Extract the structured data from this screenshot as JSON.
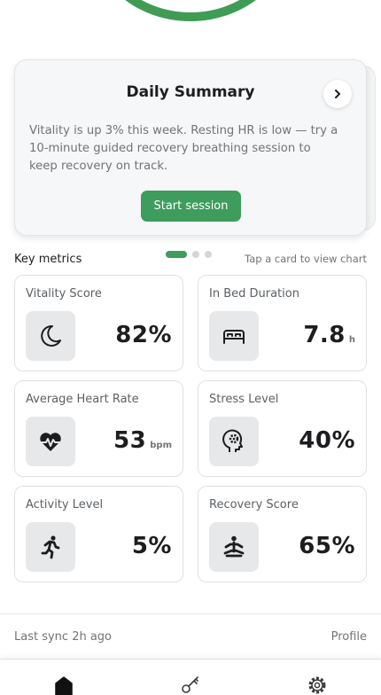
{
  "summary": {
    "title": "Daily Summary",
    "body": "Vitality is up 3% this week. Resting HR is low — try a 10-minute guided recovery breathing session to keep recovery on track.",
    "button_label": "Start session",
    "next_icon": "chevron-right-icon",
    "pager": {
      "count": 3,
      "active": 1
    }
  },
  "metrics": {
    "heading": "Key metrics",
    "hint": "Tap a card to view chart",
    "items": [
      {
        "label": "Vitality Score",
        "value": "82%",
        "unit": "",
        "icon": "moon-icon"
      },
      {
        "label": "In Bed Duration",
        "value": "7.8",
        "unit": "h",
        "icon": "bed-icon"
      },
      {
        "label": "Average Heart Rate",
        "value": "53",
        "unit": "bpm",
        "icon": "heart-rate-icon"
      },
      {
        "label": "Stress Level",
        "value": "40%",
        "unit": "",
        "icon": "head-gear-icon"
      },
      {
        "label": "Activity Level",
        "value": "5%",
        "unit": "",
        "icon": "running-icon"
      },
      {
        "label": "Recovery Score",
        "value": "65%",
        "unit": "",
        "icon": "meditation-icon"
      }
    ]
  },
  "footer": {
    "sync": "Last sync 2h ago",
    "profile": "Profile"
  },
  "tabs": [
    {
      "icon": "home-icon"
    },
    {
      "icon": "key-icon"
    },
    {
      "icon": "settings-icon"
    }
  ],
  "colors": {
    "accent": "#3e9c5c",
    "ring": "#3f9c54",
    "tile_border": "#dfe1e4",
    "icon_bg": "#e7e8ea"
  }
}
